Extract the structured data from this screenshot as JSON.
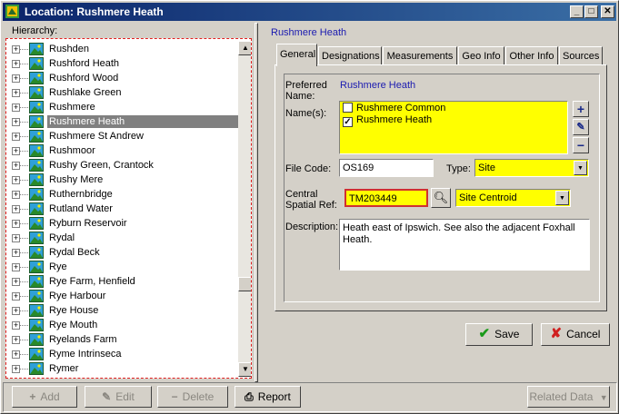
{
  "window": {
    "title": "Location: Rushmere Heath",
    "controls": {
      "minimize": "_",
      "maximize": "□",
      "close": "✕"
    }
  },
  "hierarchy": {
    "label": "Hierarchy:",
    "items": [
      {
        "label": "Rushden"
      },
      {
        "label": "Rushford Heath"
      },
      {
        "label": "Rushford Wood"
      },
      {
        "label": "Rushlake Green"
      },
      {
        "label": "Rushmere"
      },
      {
        "label": "Rushmere Heath",
        "selected": true
      },
      {
        "label": "Rushmere St Andrew"
      },
      {
        "label": "Rushmoor"
      },
      {
        "label": "Rushy Green, Crantock"
      },
      {
        "label": "Rushy Mere"
      },
      {
        "label": "Ruthernbridge"
      },
      {
        "label": "Rutland Water"
      },
      {
        "label": "Ryburn Reservoir"
      },
      {
        "label": "Rydal"
      },
      {
        "label": "Rydal Beck"
      },
      {
        "label": "Rye"
      },
      {
        "label": "Rye Farm, Henfield"
      },
      {
        "label": "Rye Harbour"
      },
      {
        "label": "Rye House"
      },
      {
        "label": "Rye Mouth"
      },
      {
        "label": "Ryelands Farm"
      },
      {
        "label": "Ryme Intrinseca"
      },
      {
        "label": "Rymer"
      }
    ],
    "expander_glyph": "+"
  },
  "detail": {
    "heading": "Rushmere Heath",
    "tabs": [
      "General",
      "Designations",
      "Measurements",
      "Geo Info",
      "Other Info",
      "Sources"
    ],
    "active_tab": "General",
    "preferred_name_label": "Preferred Name:",
    "preferred_name_value": "Rushmere Heath",
    "names_label": "Name(s):",
    "names": [
      {
        "label": "Rushmere Common",
        "checked": false
      },
      {
        "label": "Rushmere Heath",
        "checked": true
      }
    ],
    "file_code_label": "File Code:",
    "file_code_value": "OS169",
    "type_label": "Type:",
    "type_value": "Site",
    "spatial_ref_label": "Central Spatial Ref:",
    "spatial_ref_value": "TM203449",
    "spatial_ref_system": "Site Centroid",
    "description_label": "Description:",
    "description_value": "Heath east of Ipswich. See also the adjacent Foxhall Heath."
  },
  "actions": {
    "save": "Save",
    "cancel": "Cancel",
    "add": "Add",
    "edit": "Edit",
    "delete": "Delete",
    "report": "Report",
    "related_data": "Related Data"
  },
  "colors": {
    "title_gradient_start": "#0a246a",
    "title_gradient_end": "#3a6ea5",
    "required_field": "#ffff00",
    "link_blue": "#1a1ab0",
    "selection": "#808080"
  }
}
